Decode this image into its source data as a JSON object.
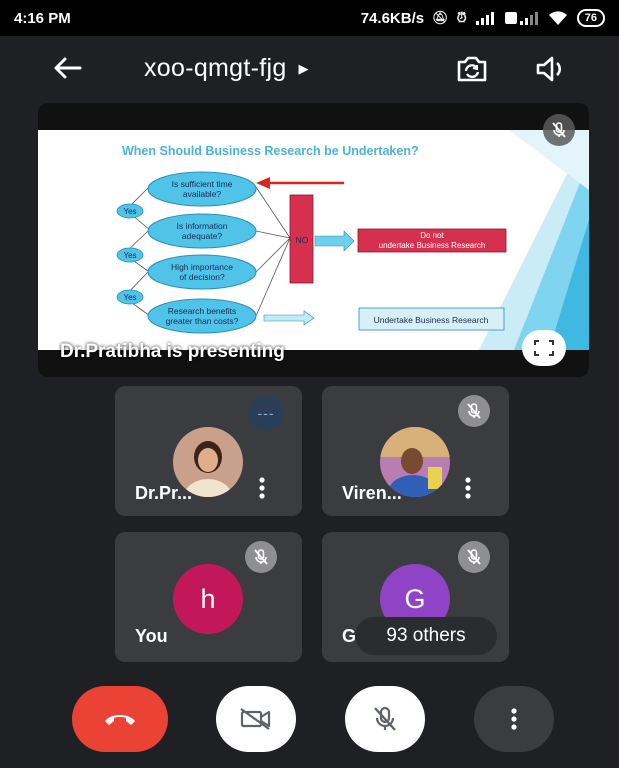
{
  "status_bar": {
    "time": "4:16 PM",
    "network_speed": "74.6KB/s",
    "battery": "76"
  },
  "meeting": {
    "code": "xoo-qmgt-fjg"
  },
  "presentation": {
    "presenting_text": "Dr.Pratibha is presenting",
    "slide": {
      "title": "When Should Business Research be Undertaken?",
      "questions": [
        "Is sufficient time available?",
        "Is information adequate?",
        "High importance of decision?",
        "Research benefits greater than costs?"
      ],
      "yes_labels": [
        "Yes",
        "Yes",
        "Yes"
      ],
      "no_label": "NO",
      "outcome_no": "Do not undertake Business Research",
      "outcome_yes": "Undertake Business Research"
    }
  },
  "participants": [
    {
      "name": "Dr.Pr...",
      "avatar": "photo",
      "speaking_indicator": "---"
    },
    {
      "name": "Viren...",
      "avatar": "photo",
      "muted": true
    },
    {
      "name": "You",
      "avatar_letter": "h",
      "avatar_color": "#c2185b",
      "muted": true
    },
    {
      "name": "GG",
      "avatar_letter": "G",
      "avatar_color": "#8e44c4",
      "muted": true
    }
  ],
  "others_label": "93 others",
  "colors": {
    "background": "#1f2023",
    "tile": "#3b3c40",
    "end_call": "#ea4335",
    "control_light": "#ffffff",
    "control_dark": "#3b3c40"
  },
  "icons": {
    "back": "arrow-left-icon",
    "camera_switch": "camera-switch-icon",
    "speaker": "speaker-icon",
    "mic_off": "mic-off-icon",
    "fullscreen": "fullscreen-icon",
    "more": "more-vert-icon",
    "end_call": "end-call-icon",
    "video_off": "video-off-icon"
  }
}
